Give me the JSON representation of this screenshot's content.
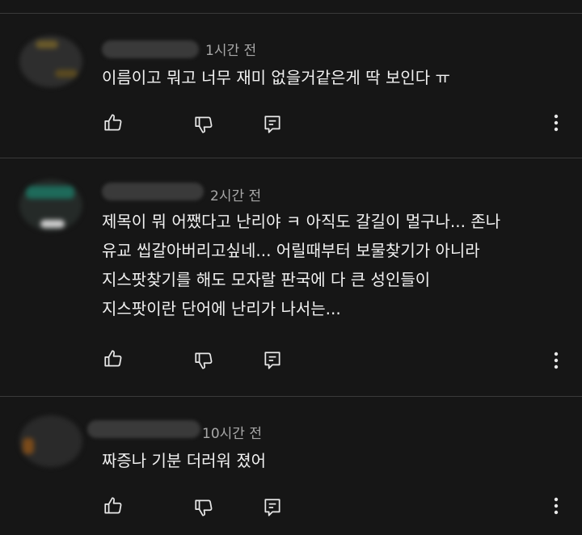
{
  "comments": [
    {
      "avatar_label": "avatar",
      "time": "1시간 전",
      "text": "이름이고 뭐고 너무 재미 없을거같은게 딱 보인다 ㅠ",
      "actions": {
        "like_icon": "thumbs-up-icon",
        "dislike_icon": "thumbs-down-icon",
        "reply_icon": "reply-icon",
        "more_icon": "more-vertical-icon"
      }
    },
    {
      "avatar_label": "avatar",
      "time": "2시간 전",
      "text": "제목이 뭐 어쨌다고 난리야 ㅋ 아직도 갈길이 멀구나... 존나\n유교 씹갈아버리고싶네... 어릴때부터 보물찾기가 아니라\n지스팟찾기를 해도 모자랄 판국에 다 큰 성인들이\n지스팟이란 단어에 난리가 나서는...",
      "actions": {
        "like_icon": "thumbs-up-icon",
        "dislike_icon": "thumbs-down-icon",
        "reply_icon": "reply-icon",
        "more_icon": "more-vertical-icon"
      }
    },
    {
      "avatar_label": "avatar",
      "time": "10시간 전",
      "text": "짜증나 기분 더러워 졌어",
      "actions": {
        "like_icon": "thumbs-up-icon",
        "dislike_icon": "thumbs-down-icon",
        "reply_icon": "reply-icon",
        "more_icon": "more-vertical-icon"
      }
    }
  ],
  "colors": {
    "background": "#161616",
    "text": "#f1f1f1",
    "muted": "#a8a8a8",
    "divider": "#3a3a3a"
  }
}
